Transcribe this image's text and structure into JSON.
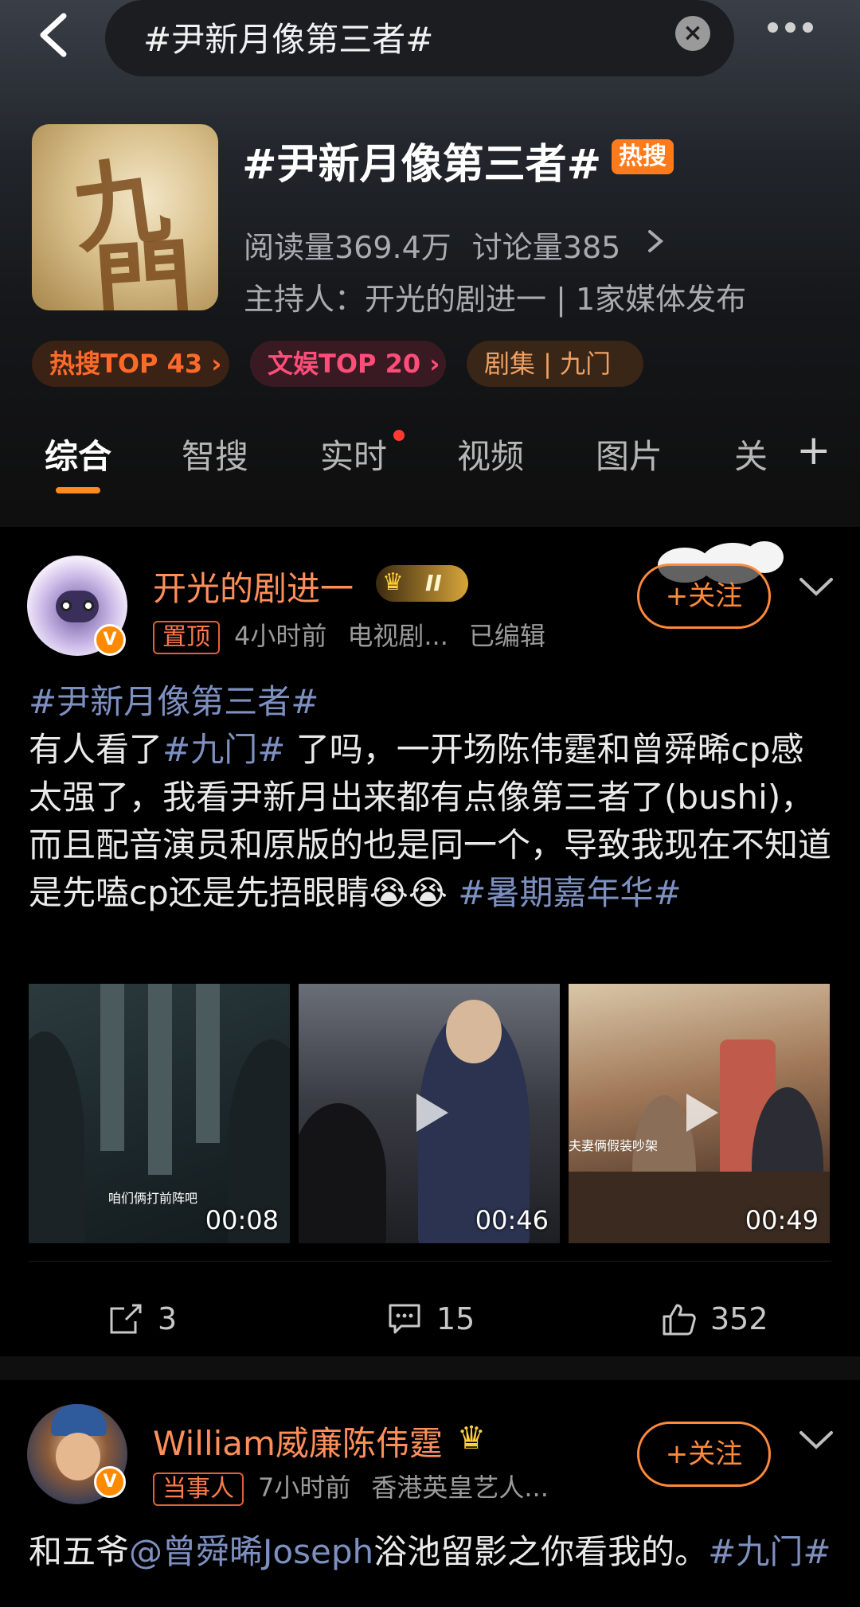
{
  "search": {
    "query": "#尹新月像第三者#"
  },
  "topic": {
    "title": "#尹新月像第三者#",
    "hot_badge": "热搜",
    "reads": "阅读量369.4万",
    "discussions": "讨论量385",
    "host": "主持人：开光的剧进一 | 1家媒体发布",
    "cover_glyphs": [
      "九",
      "門"
    ]
  },
  "tags": [
    {
      "label": "热搜TOP 43 ›"
    },
    {
      "label": "文娱TOP 20 ›"
    },
    {
      "label": "剧集 | 九门"
    }
  ],
  "tabs": [
    {
      "label": "综合"
    },
    {
      "label": "智搜"
    },
    {
      "label": "实时"
    },
    {
      "label": "视频"
    },
    {
      "label": "图片"
    },
    {
      "label": "关"
    }
  ],
  "plus_tab": "+",
  "posts": [
    {
      "author": "开光的剧进一",
      "level": "II",
      "label": "置顶",
      "time": "4小时前",
      "source": "电视剧...",
      "edited": "已编辑",
      "follow": "+关注",
      "text_parts": {
        "t1": "#尹新月像第三者#",
        "t2": "有人看了",
        "t3": "#九门#",
        "t4": " 了吗，一开场陈伟霆和曾舜晞cp感太强了，我看尹新月出来都有点像第三者了(bushi)，而且配音演员和原版的也是同一个，导致我现在不知道是先嗑cp还是先捂眼睛😭😭 ",
        "t5": "#暑期嘉年华#"
      },
      "videos": [
        {
          "duration": "00:08",
          "caption": "咱们俩打前阵吧"
        },
        {
          "duration": "00:46"
        },
        {
          "duration": "00:49",
          "caption": "夫妻俩假装吵架"
        }
      ],
      "shares": "3",
      "comments": "15",
      "likes": "352"
    },
    {
      "author": "William威廉陈伟霆",
      "label": "当事人",
      "time": "7小时前",
      "source": "香港英皇艺人...",
      "follow": "+关注",
      "text_parts": {
        "t1": "和五爷",
        "t2": "@曾舜晞Joseph",
        "t3": "浴池留影之你看我的。",
        "t4": "#九门#"
      }
    }
  ],
  "colors": {
    "accent": "#ff8a1e",
    "author": "#ff8f5a",
    "hashtag": "#7d90c0",
    "hot_badge": "#ff7a1a"
  }
}
